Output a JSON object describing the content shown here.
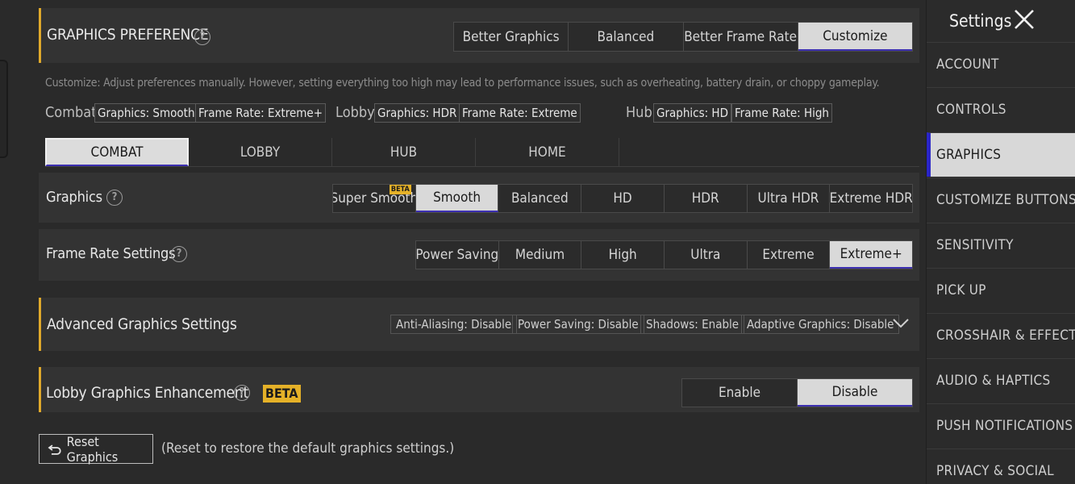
{
  "preference": {
    "title": "GRAPHICS PREFERENCE",
    "options": [
      "Better Graphics",
      "Balanced",
      "Better Frame Rate",
      "Customize"
    ],
    "active_index": 3
  },
  "description": "Customize: Adjust preferences manually. However, setting everything too high may lead to performance issues, such as overheating, battery drain, or choppy gameplay.",
  "summary": {
    "combat_label": "Combat",
    "combat_graphics": "Graphics: Smooth",
    "combat_framerate": "Frame Rate: Extreme+",
    "lobby_label": "Lobby",
    "lobby_graphics": "Graphics: HDR",
    "lobby_framerate": "Frame Rate: Extreme",
    "hub_label": "Hub",
    "hub_graphics": "Graphics: HD",
    "hub_framerate": "Frame Rate: High"
  },
  "tabs": [
    "COMBAT",
    "LOBBY",
    "HUB",
    "HOME"
  ],
  "graphics": {
    "label": "Graphics",
    "options": [
      "Super Smooth",
      "Smooth",
      "Balanced",
      "HD",
      "HDR",
      "Ultra HDR",
      "Extreme HDR"
    ],
    "beta_tag": "BETA"
  },
  "framerate": {
    "label": "Frame Rate Settings",
    "options": [
      "Power Saving",
      "Medium",
      "High",
      "Ultra",
      "Extreme",
      "Extreme+"
    ]
  },
  "advanced": {
    "title": "Advanced Graphics Settings",
    "tags": [
      "Anti-Aliasing: Disable",
      "Power Saving: Disable",
      "Shadows: Enable",
      "Adaptive Graphics: Disable"
    ]
  },
  "lobby_enhance": {
    "title": "Lobby Graphics Enhancement",
    "beta": "BETA",
    "options": [
      "Enable",
      "Disable"
    ]
  },
  "reset": {
    "label": "Reset Graphics",
    "note": "(Reset to restore the default graphics settings.)"
  },
  "sidebar": {
    "title": "Settings",
    "items": [
      "ACCOUNT",
      "CONTROLS",
      "GRAPHICS",
      "CUSTOMIZE BUTTONS",
      "SENSITIVITY",
      "PICK UP",
      "CROSSHAIR & EFFECTS",
      "AUDIO & HAPTICS",
      "PUSH NOTIFICATIONS",
      "PRIVACY & SOCIAL"
    ],
    "active": "GRAPHICS"
  },
  "colors": {
    "accent": "#e0a92b",
    "active_underline": "#3c2fb0",
    "sidebar_active_bar": "#2a25c7"
  }
}
